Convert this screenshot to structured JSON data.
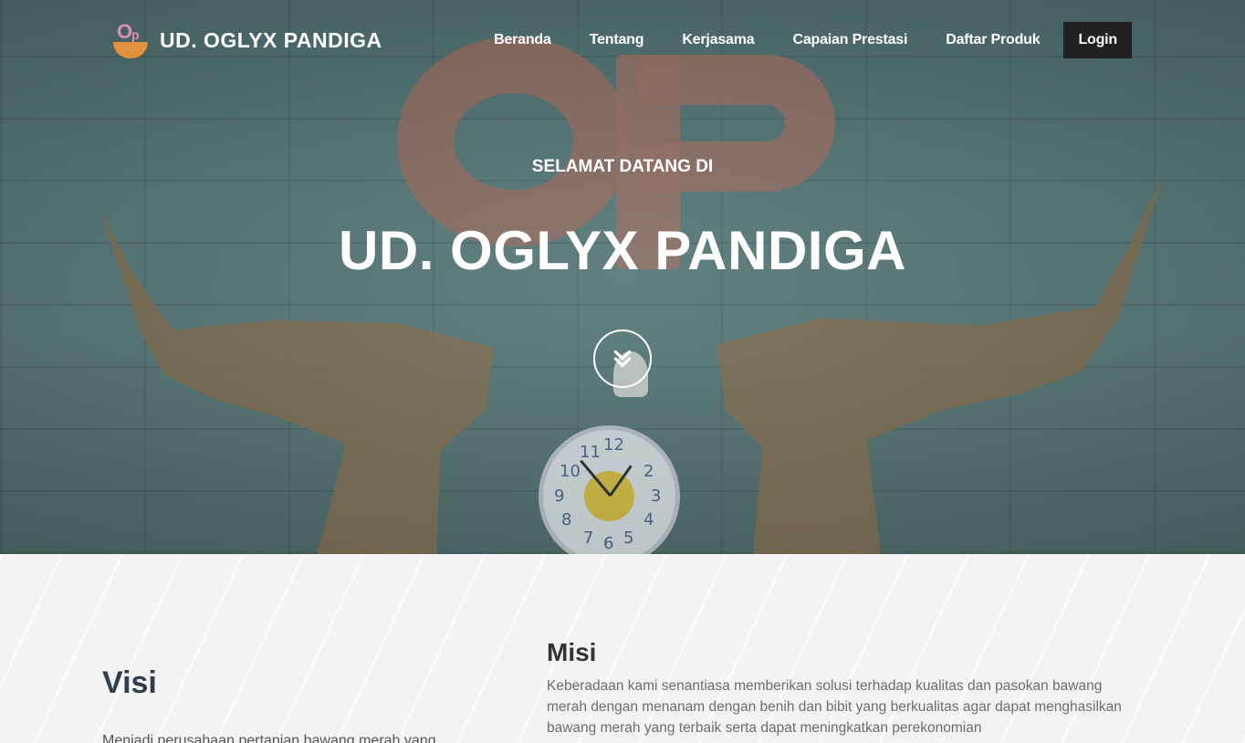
{
  "brand": {
    "name": "UD. OGLYX PANDIGA",
    "logo_letter_o": "O",
    "logo_letter_p": "p"
  },
  "nav": {
    "items": [
      "Beranda",
      "Tentang",
      "Kerjasama",
      "Capaian Prestasi",
      "Daftar Produk"
    ],
    "login": "Login"
  },
  "hero": {
    "subtitle": "SELAMAT DATANG DI",
    "title": "UD. OGLYX PANDIGA",
    "scroll_icon": "chevron-double-down-icon"
  },
  "visi": {
    "title": "Visi",
    "text": "Menjadi perusahaan pertanian bawang merah yang"
  },
  "misi": {
    "title": "Misi",
    "text": "Keberadaan kami senantiasa memberikan solusi terhadap kualitas dan pasokan bawang merah dengan menanam dengan benih dan bibit yang berkualitas agar dapat menghasilkan bawang merah yang terbaik serta dapat meningkatkan perekonomian"
  },
  "colors": {
    "login_bg": "#212121",
    "visi_title": "#2c3e50",
    "logo_pink": "#e08cb6",
    "logo_orange": "#e0913a"
  }
}
